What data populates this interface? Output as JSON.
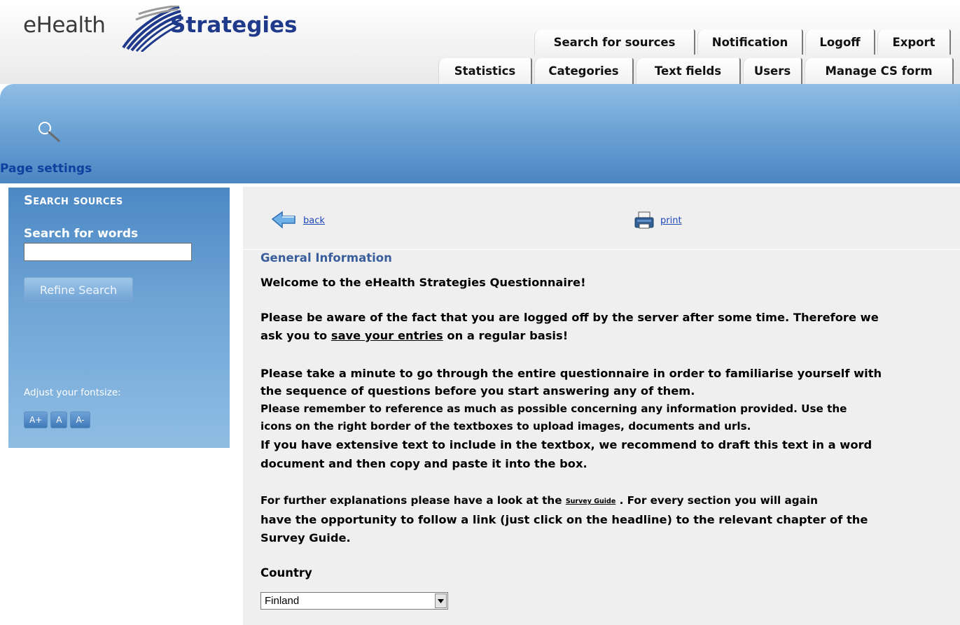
{
  "header": {
    "logo_ehealth": "eHealth",
    "logo_strategies": "Strategies",
    "tabs_top": [
      "Search for sources",
      "Notification",
      "Logoff",
      "Export"
    ],
    "tabs_bottom": [
      "Statistics",
      "Categories",
      "Text fields",
      "Users",
      "Manage CS form"
    ]
  },
  "sidebar": {
    "title": "Search sources",
    "search_label": "Search for words",
    "search_value": "",
    "refine_label": "Refine Search",
    "page_settings": "Page settings",
    "adjust_label": "Adjust your fontsize:",
    "font_buttons": [
      "A+",
      "A",
      "A-"
    ]
  },
  "main": {
    "back_label": "back",
    "print_label": "print",
    "section_title": "General Information",
    "welcome": "Welcome to the eHealth Strategies Questionnaire!",
    "logoff_line1": "Please be aware of the fact that you are logged off by the server after some time. Therefore we",
    "logoff_prefix": "ask you to ",
    "save_link": "save your entries",
    "logoff_suffix": " on a regular basis!",
    "minute_line1": "Please take a minute to go through the entire questionnaire in order to familiarise yourself with",
    "minute_line2": "the sequence of questions before you start answering any of them.",
    "reference_line1": "Please remember to reference as much as possible concerning any information provided. Use the",
    "reference_line2": "icons on the right border of the textboxes to upload images, documents and urls.",
    "extensive_line1": "If you have extensive text to include in the textbox, we recommend to draft this text in a word",
    "extensive_line2": "document and then copy and paste it into the box.",
    "further_prefix": "For further explanations please have a look at the ",
    "survey_guide_link": "Survey Guide",
    "further_suffix": " . For every section you will again",
    "further_line2": "have the opportunity to follow a link (just click on the headline) to the relevant chapter of the",
    "further_line3": "Survey Guide.",
    "country_label": "Country",
    "country_value": "Finland"
  },
  "colors": {
    "banner_blue": "#6da4d6",
    "sidebar_blue": "#4c88c4",
    "section_title": "#3a5e9c",
    "link_blue": "#1e47b8"
  },
  "icons": {
    "banner": "search-icon",
    "back": "back-arrow-icon",
    "print": "printer-icon",
    "select": "chevron-down-icon"
  }
}
